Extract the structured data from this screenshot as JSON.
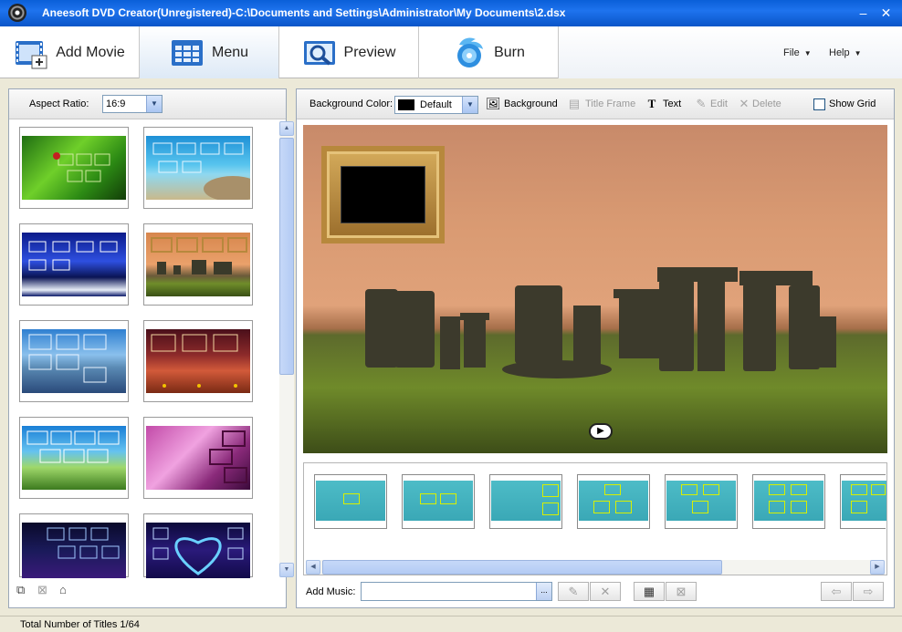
{
  "window": {
    "title": "Aneesoft DVD Creator(Unregistered)-C:\\Documents and Settings\\Administrator\\My Documents\\2.dsx",
    "minimize": "–",
    "close": "✕"
  },
  "toolbar": {
    "tabs": [
      {
        "label": "Add Movie",
        "icon": "film-add-icon",
        "active": false
      },
      {
        "label": "Menu",
        "icon": "menu-grid-icon",
        "active": true
      },
      {
        "label": "Preview",
        "icon": "preview-icon",
        "active": false
      },
      {
        "label": "Burn",
        "icon": "burn-disc-icon",
        "active": false
      }
    ],
    "menus": [
      {
        "label": "File"
      },
      {
        "label": "Help"
      }
    ]
  },
  "left_panel": {
    "aspect_label": "Aspect Ratio:",
    "aspect_value": "16:9"
  },
  "right_panel": {
    "bg_color_label": "Background Color:",
    "bg_color_value": "Default",
    "background_btn": "Background",
    "title_frame_btn": "Title Frame",
    "text_btn": "Text",
    "edit_btn": "Edit",
    "delete_btn": "Delete",
    "show_grid_label": "Show Grid",
    "add_music_label": "Add Music:",
    "music_browse": "..."
  },
  "status": {
    "text": "Total Number of Titles 1/64"
  },
  "colors": {
    "accent": "#0a5fd8",
    "panel_border": "#9aa7b8"
  }
}
